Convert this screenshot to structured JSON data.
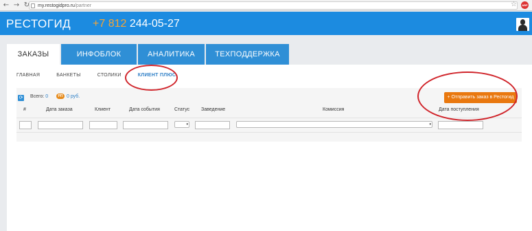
{
  "browser": {
    "back": "←",
    "forward": "→",
    "reload": "↻",
    "url_host": "my.restogidpro.ru",
    "url_path": "/partner",
    "star": "☆",
    "extension_label": "ABP"
  },
  "header": {
    "logo": "РЕСТОГИД",
    "phone_code": "+7 812",
    "phone_number": " 244-05-27"
  },
  "tabs": [
    {
      "label": "ЗАКАЗЫ",
      "active": true
    },
    {
      "label": "ИНФОБЛОК",
      "active": false
    },
    {
      "label": "АНАЛИТИКА",
      "active": false
    },
    {
      "label": "ТЕХПОДДЕРЖКА",
      "active": false
    }
  ],
  "subnav": [
    {
      "label": "ГЛАВНАЯ",
      "active": false
    },
    {
      "label": "БАНКЕТЫ",
      "active": false
    },
    {
      "label": "СТОЛИКИ",
      "active": false
    },
    {
      "label": "КЛИЕНТ ПЛЮС",
      "active": true
    }
  ],
  "summary": {
    "total_label": "Всего: ",
    "total_value": "0",
    "badge": "РП",
    "sum": "0 руб."
  },
  "send_button": "+ Отправить заказ в Рестогид",
  "columns": [
    "#",
    "Дата заказа",
    "Клиент",
    "Дата события",
    "Статус",
    "Заведение",
    "Комиссия",
    "Дата поступления"
  ],
  "select_arrow": "▾",
  "icons": {
    "refresh": "⟳"
  },
  "colors": {
    "header": "#1c8be0",
    "tab": "#2f8fd6",
    "accent_orange": "#e9780f",
    "annotation": "#d0242a"
  }
}
